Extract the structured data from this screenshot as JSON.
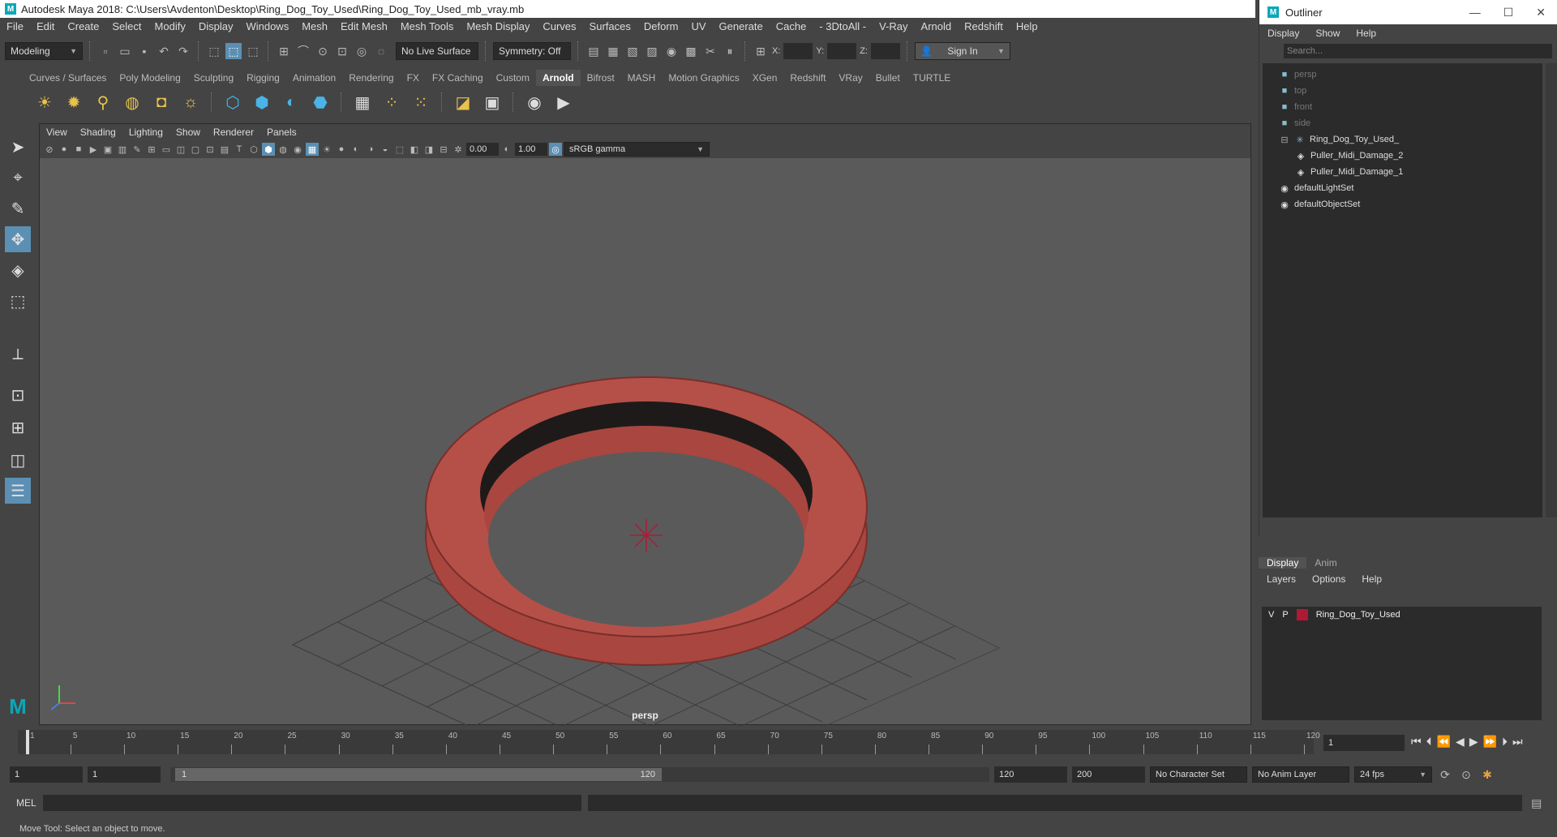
{
  "window": {
    "title": "Autodesk Maya 2018: C:\\Users\\Avdenton\\Desktop\\Ring_Dog_Toy_Used\\Ring_Dog_Toy_Used_mb_vray.mb",
    "logo": "M"
  },
  "menu": [
    "File",
    "Edit",
    "Create",
    "Select",
    "Modify",
    "Display",
    "Windows",
    "Mesh",
    "Edit Mesh",
    "Mesh Tools",
    "Mesh Display",
    "Curves",
    "Surfaces",
    "Deform",
    "UV",
    "Generate",
    "Cache",
    "- 3DtoAll -",
    "V-Ray",
    "Arnold",
    "Redshift",
    "Help"
  ],
  "toolbar": {
    "mode": "Modeling",
    "live_surface": "No Live Surface",
    "symmetry": "Symmetry: Off",
    "x_label": "X:",
    "y_label": "Y:",
    "z_label": "Z:",
    "sign_in": "Sign In"
  },
  "shelf_tabs": [
    "Curves / Surfaces",
    "Poly Modeling",
    "Sculpting",
    "Rigging",
    "Animation",
    "Rendering",
    "FX",
    "FX Caching",
    "Custom",
    "Arnold",
    "Bifrost",
    "MASH",
    "Motion Graphics",
    "XGen",
    "Redshift",
    "VRay",
    "Bullet",
    "TURTLE"
  ],
  "shelf_active": "Arnold",
  "viewport": {
    "menu": [
      "View",
      "Shading",
      "Lighting",
      "Show",
      "Renderer",
      "Panels"
    ],
    "exposure": "0.00",
    "gamma": "1.00",
    "color_space": "sRGB gamma",
    "camera": "persp"
  },
  "outliner": {
    "title": "Outliner",
    "menu": [
      "Display",
      "Show",
      "Help"
    ],
    "search_placeholder": "Search...",
    "items": [
      {
        "label": "persp",
        "icon": "camera-icon",
        "indent": 0,
        "dim": true
      },
      {
        "label": "top",
        "icon": "camera-icon",
        "indent": 0,
        "dim": true
      },
      {
        "label": "front",
        "icon": "camera-icon",
        "indent": 0,
        "dim": true
      },
      {
        "label": "side",
        "icon": "camera-icon",
        "indent": 0,
        "dim": true
      },
      {
        "label": "Ring_Dog_Toy_Used_",
        "icon": "group-icon",
        "indent": 0,
        "dim": false
      },
      {
        "label": "Puller_Midi_Damage_2",
        "icon": "mesh-icon",
        "indent": 1,
        "dim": false
      },
      {
        "label": "Puller_Midi_Damage_1",
        "icon": "mesh-icon",
        "indent": 1,
        "dim": false
      },
      {
        "label": "defaultLightSet",
        "icon": "set-icon",
        "indent": 0,
        "dim": false
      },
      {
        "label": "defaultObjectSet",
        "icon": "set-icon",
        "indent": 0,
        "dim": false
      }
    ]
  },
  "layers": {
    "tabs": [
      "Display",
      "Anim"
    ],
    "menu": [
      "Layers",
      "Options",
      "Help"
    ],
    "row": {
      "v": "V",
      "p": "P",
      "name": "Ring_Dog_Toy_Used",
      "color": "#b01935"
    }
  },
  "timeline": {
    "ticks": [
      "1",
      "5",
      "10",
      "15",
      "20",
      "25",
      "30",
      "35",
      "40",
      "45",
      "50",
      "55",
      "60",
      "65",
      "70",
      "75",
      "80",
      "85",
      "90",
      "95",
      "100",
      "105",
      "110",
      "115",
      "120"
    ],
    "current_frame": "1"
  },
  "range": {
    "start": "1",
    "start2": "1",
    "slider_start": "1",
    "slider_end": "120",
    "end": "120",
    "end2": "200",
    "character_set": "No Character Set",
    "anim_layer": "No Anim Layer",
    "fps": "24 fps"
  },
  "command": {
    "label": "MEL"
  },
  "status": "Move Tool: Select an object to move."
}
